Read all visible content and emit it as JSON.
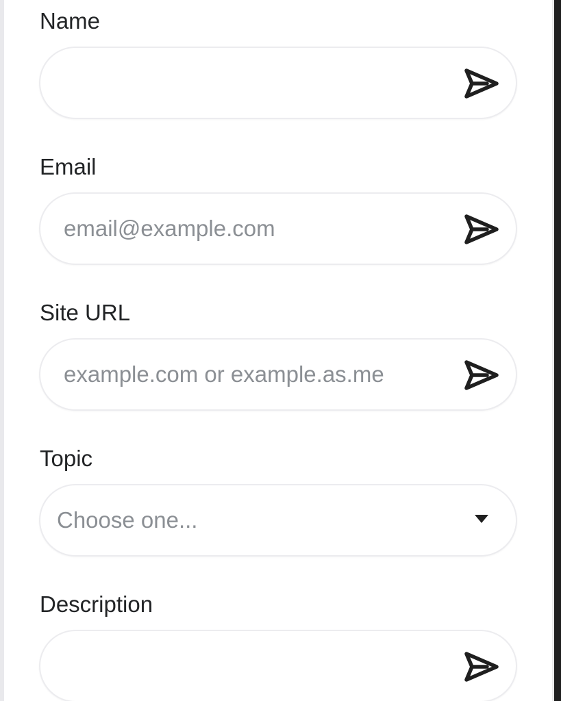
{
  "form": {
    "name": {
      "label": "Name",
      "value": "",
      "placeholder": "",
      "action_icon": "send-icon"
    },
    "email": {
      "label": "Email",
      "value": "",
      "placeholder": "email@example.com",
      "action_icon": "send-icon"
    },
    "site_url": {
      "label": "Site URL",
      "value": "",
      "placeholder": "example.com or example.as.me",
      "action_icon": "send-icon"
    },
    "topic": {
      "label": "Topic",
      "selected": "Choose one...",
      "action_icon": "caret-down-icon"
    },
    "description": {
      "label": "Description",
      "value": "",
      "placeholder": "",
      "action_icon": "send-icon"
    }
  },
  "colors": {
    "label_text": "#222426",
    "placeholder_text": "#8b8f94",
    "field_border": "#ececef",
    "icon": "#1f1f1f"
  }
}
